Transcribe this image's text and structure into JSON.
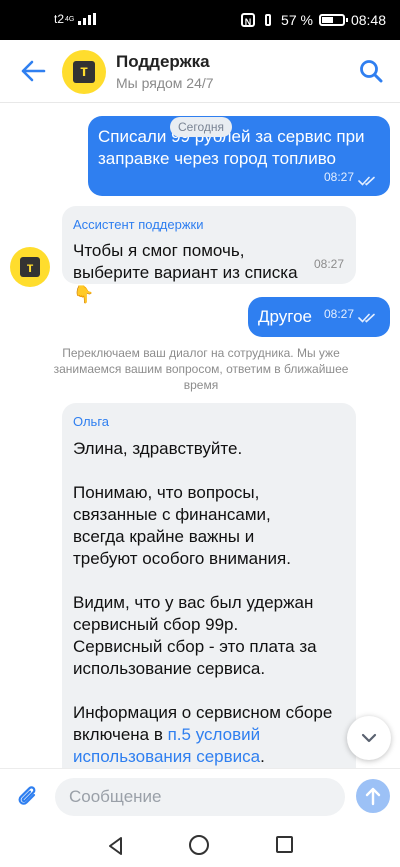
{
  "status_bar": {
    "carrier": "t2",
    "network": "4G",
    "battery": "57 %",
    "battery_level": 0.57,
    "time": "08:48"
  },
  "header": {
    "title": "Поддержка",
    "subtitle": "Мы рядом 24/7",
    "avatar_letter": "т",
    "icons": {
      "back": "arrow-left-icon",
      "search": "search-icon"
    }
  },
  "chat": {
    "date_separator": "Сегодня",
    "messages": [
      {
        "direction": "outgoing",
        "text": "Списали 99 рублей за сервис при заправке через город топливо",
        "time": "08:27",
        "read": true
      },
      {
        "direction": "incoming",
        "sender": "Ассистент поддержки",
        "text": "Чтобы я смог помочь, выберите вариант из списка 👇",
        "time": "08:27"
      },
      {
        "direction": "outgoing",
        "text": "Другое",
        "time": "08:27",
        "read": true
      }
    ],
    "system_note": "Переключаем ваш диалог на сотрудника. Мы уже занимаемся вашим вопросом, ответим в ближайшее время",
    "operator_message": {
      "sender": "Ольга",
      "greeting": "Элина, здравствуйте.",
      "paragraph1": "Понимаю, что вопросы, связанные с финансами, всегда крайне важны и требуют особого внимания.",
      "paragraph2": "Видим, что у вас был удержан сервисный сбор 99р. Сервисный сбор - это плата за использование сервиса.",
      "paragraph3_text": "Информация о сервисном сборе включена в ",
      "paragraph3_link": "п.5 условий использования сервиса",
      "paragraph3_end": "."
    }
  },
  "input": {
    "placeholder": "Сообщение",
    "icons": {
      "attach": "paperclip-icon",
      "send": "arrow-up-icon",
      "scroll_down": "chevron-down-icon"
    }
  },
  "colors": {
    "accent": "#2f7ff0",
    "brand_yellow": "#ffdd2d",
    "incoming_bubble": "#eff1f3"
  }
}
